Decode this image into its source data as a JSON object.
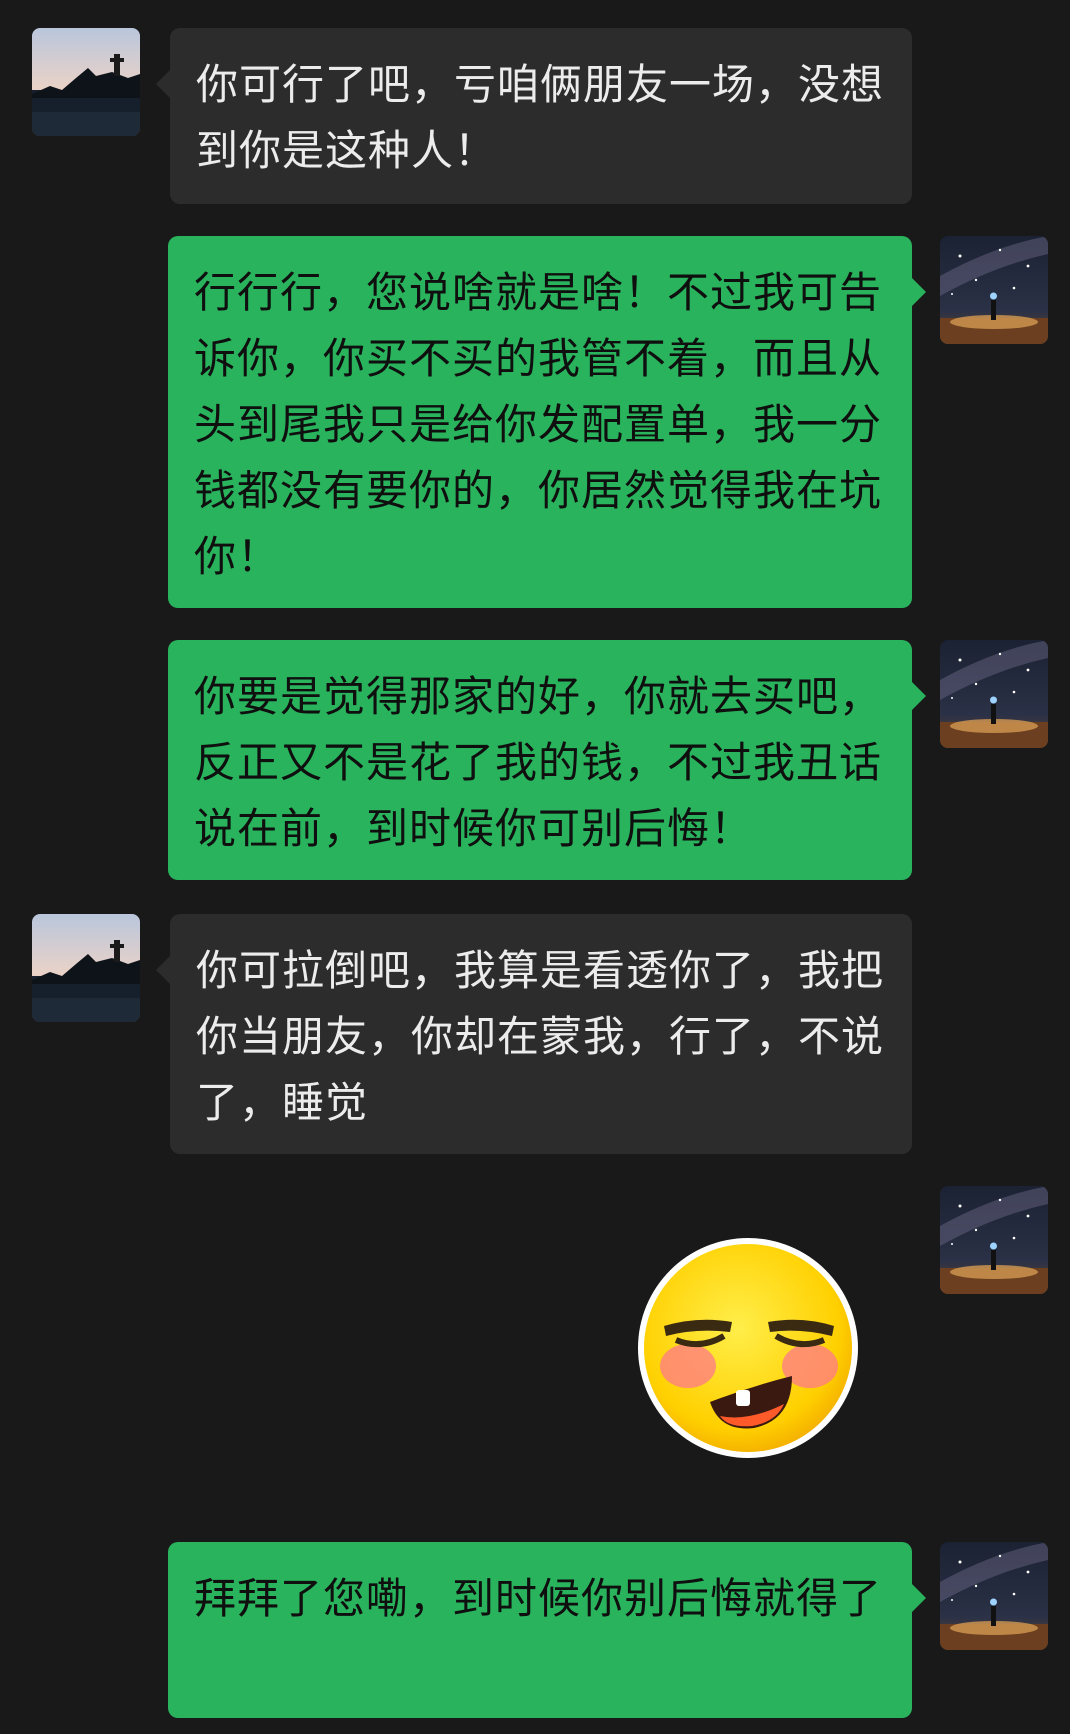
{
  "chat": {
    "messages": [
      {
        "sender": "friend",
        "text": "你可行了吧，亏咱俩朋友一场，没想到你是这种人！"
      },
      {
        "sender": "me",
        "text": "行行行，您说啥就是啥！不过我可告诉你，你买不买的我管不着，而且从头到尾我只是给你发配置单，我一分钱都没有要你的，你居然觉得我在坑你！"
      },
      {
        "sender": "me",
        "text": "你要是觉得那家的好，你就去买吧，反正又不是花了我的钱，不过我丑话说在前，到时候你可别后悔！"
      },
      {
        "sender": "friend",
        "text": "你可拉倒吧，我算是看透你了，我把你当朋友，你却在蒙我，行了，不说了，睡觉"
      },
      {
        "sender": "me",
        "type": "sticker",
        "icon": "smirk-emoji-icon"
      },
      {
        "sender": "me",
        "text": "拜拜了您嘞，到时候你别后悔就得了"
      }
    ]
  },
  "colors": {
    "background": "#191919",
    "incoming_bubble": "#2c2c2c",
    "outgoing_bubble": "#29b35d"
  }
}
